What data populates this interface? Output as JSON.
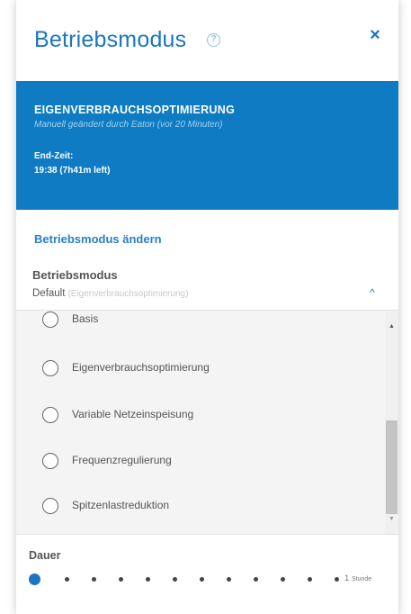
{
  "header": {
    "title": "Betriebsmodus",
    "help_icon": "?",
    "close_icon": "×"
  },
  "banner": {
    "mode": "EIGENVERBRAUCHSOPTIMIERUNG",
    "changed_by": "Manuell geändert durch Eaton (vor 20 Minuten)",
    "end_label": "End-Zeit:",
    "end_value": "19:38 (7h41m left)"
  },
  "form": {
    "section_title": "Betriebsmodus ändern",
    "mode_label": "Betriebsmodus",
    "mode_value": "Default",
    "mode_hint": "(Eigenverbrauchsoptimierung)",
    "caret_up": "^"
  },
  "dropdown": {
    "options": [
      {
        "label": "Basis"
      },
      {
        "label": "Eigenverbrauchsoptimierung"
      },
      {
        "label": "Variable Netzeinspeisung"
      },
      {
        "label": "Frequenzregulierung"
      },
      {
        "label": "Spitzenlastreduktion"
      }
    ]
  },
  "duration": {
    "label": "Dauer",
    "end_value": "1",
    "end_unit": "Stunde"
  },
  "colors": {
    "accent": "#1a76c2",
    "banner": "#0e7bc2"
  }
}
